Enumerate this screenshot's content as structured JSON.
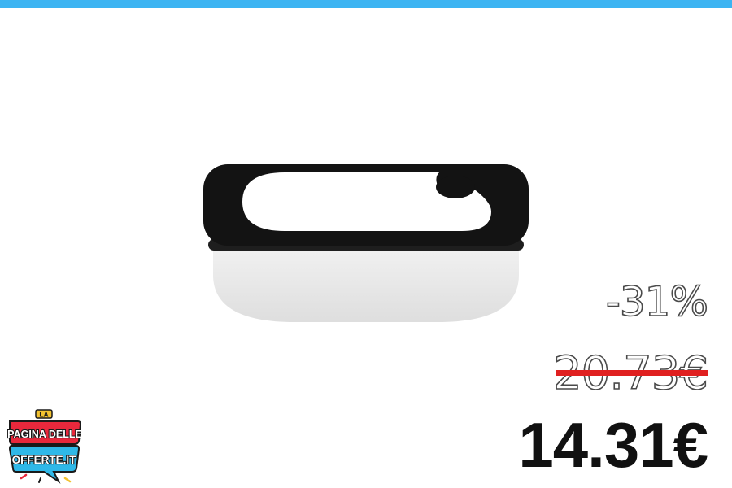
{
  "product": {
    "discount": "-31%",
    "old_price": "20.73€",
    "price": "14.31€"
  },
  "logo": {
    "line1": "LA",
    "line2": "PAGINA DELLE",
    "line3": "OFFERTE.IT"
  },
  "colors": {
    "top_bar": "#3db4f2",
    "strike": "#e02020",
    "price": "#111111"
  }
}
